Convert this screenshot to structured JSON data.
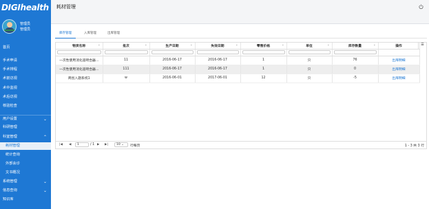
{
  "app": {
    "logo_text": "DIGIhealth",
    "page_title": "耗材管理"
  },
  "user": {
    "name": "管理员",
    "role": "管理员"
  },
  "sidebar": {
    "items": [
      {
        "label": "首页"
      },
      {
        "label": "手术申请"
      },
      {
        "label": "手术排程"
      },
      {
        "label": "术前访视"
      },
      {
        "label": "术中监视"
      },
      {
        "label": "术后访视"
      },
      {
        "label": "核验检查"
      },
      {
        "label": "用户设置"
      },
      {
        "label": "科研管理"
      },
      {
        "label": "科室管理"
      },
      {
        "label": "耗材管理"
      },
      {
        "label": "统计查询"
      },
      {
        "label": "外部会诊"
      },
      {
        "label": "文书概况"
      },
      {
        "label": "系统管理"
      },
      {
        "label": "信息查询"
      },
      {
        "label": "知识库"
      }
    ]
  },
  "tabs": [
    {
      "label": "库存管理"
    },
    {
      "label": "入库管理"
    },
    {
      "label": "出库管理"
    }
  ],
  "table": {
    "headers": [
      "物资名称",
      "批次",
      "生产日期",
      "失效日期",
      "零售价格",
      "单位",
      "库存数量",
      "操作"
    ],
    "rows": [
      [
        "一次性使用消化道吻合器...",
        "11",
        "2016-06-17",
        "2016-06-17",
        "1",
        "只",
        "76",
        "出库明细"
      ],
      [
        "一次性使用消化道吻合器...",
        "111",
        "2016-06-17",
        "2016-06-17",
        "1",
        "只",
        "0",
        "出库明细"
      ],
      [
        "商创入题系统1",
        "w",
        "2016-06-01",
        "2017-06-01",
        "12",
        "只",
        "-5",
        "出库明细"
      ]
    ]
  },
  "pager": {
    "first": "|◀",
    "prev": "◀",
    "page_value": "1",
    "page_total": "/ 1",
    "next": "▶",
    "last": "▶|",
    "page_size": "10",
    "per_page_label": "行每页",
    "summary": "1 - 3 共 3 行"
  },
  "colors": {
    "sidebar": "#1e78d4",
    "accent": "#1e78d4",
    "active_bg": "#e8f0f8"
  },
  "icons": {
    "power": "power-icon",
    "sort": "sort-icon",
    "menu": "column-menu-icon"
  }
}
